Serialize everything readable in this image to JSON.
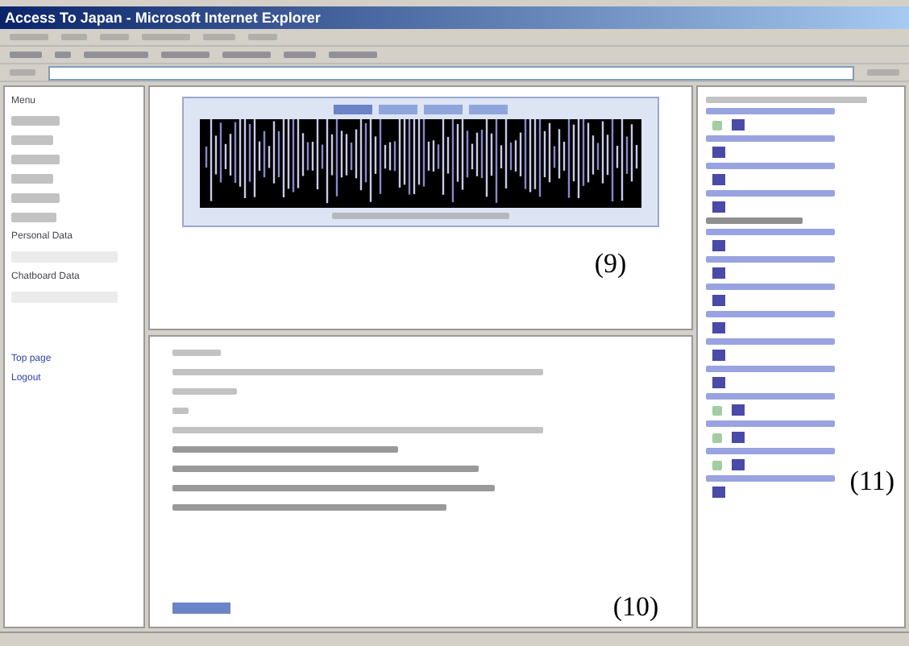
{
  "window": {
    "title": "Access To Japan - Microsoft Internet Explorer"
  },
  "sidebar": {
    "heading": "Menu",
    "sections": [
      "Personal Data",
      "Chatboard Data"
    ],
    "links": [
      "Top page",
      "Logout"
    ]
  },
  "player": {
    "buttons": [
      {
        "selected": true
      },
      {
        "selected": false
      },
      {
        "selected": false
      },
      {
        "selected": false
      }
    ],
    "label": "(9)"
  },
  "posts": {
    "label": "(10)"
  },
  "message_list": {
    "label": "(11)",
    "entries": [
      {
        "kind": "both"
      },
      {
        "kind": "mail"
      },
      {
        "kind": "mail"
      },
      {
        "kind": "mail"
      },
      {
        "kind": "header"
      },
      {
        "kind": "mail"
      },
      {
        "kind": "mail"
      },
      {
        "kind": "mail"
      },
      {
        "kind": "mail"
      },
      {
        "kind": "mail"
      },
      {
        "kind": "mail"
      },
      {
        "kind": "both"
      },
      {
        "kind": "both"
      },
      {
        "kind": "both"
      },
      {
        "kind": "mail"
      }
    ]
  }
}
